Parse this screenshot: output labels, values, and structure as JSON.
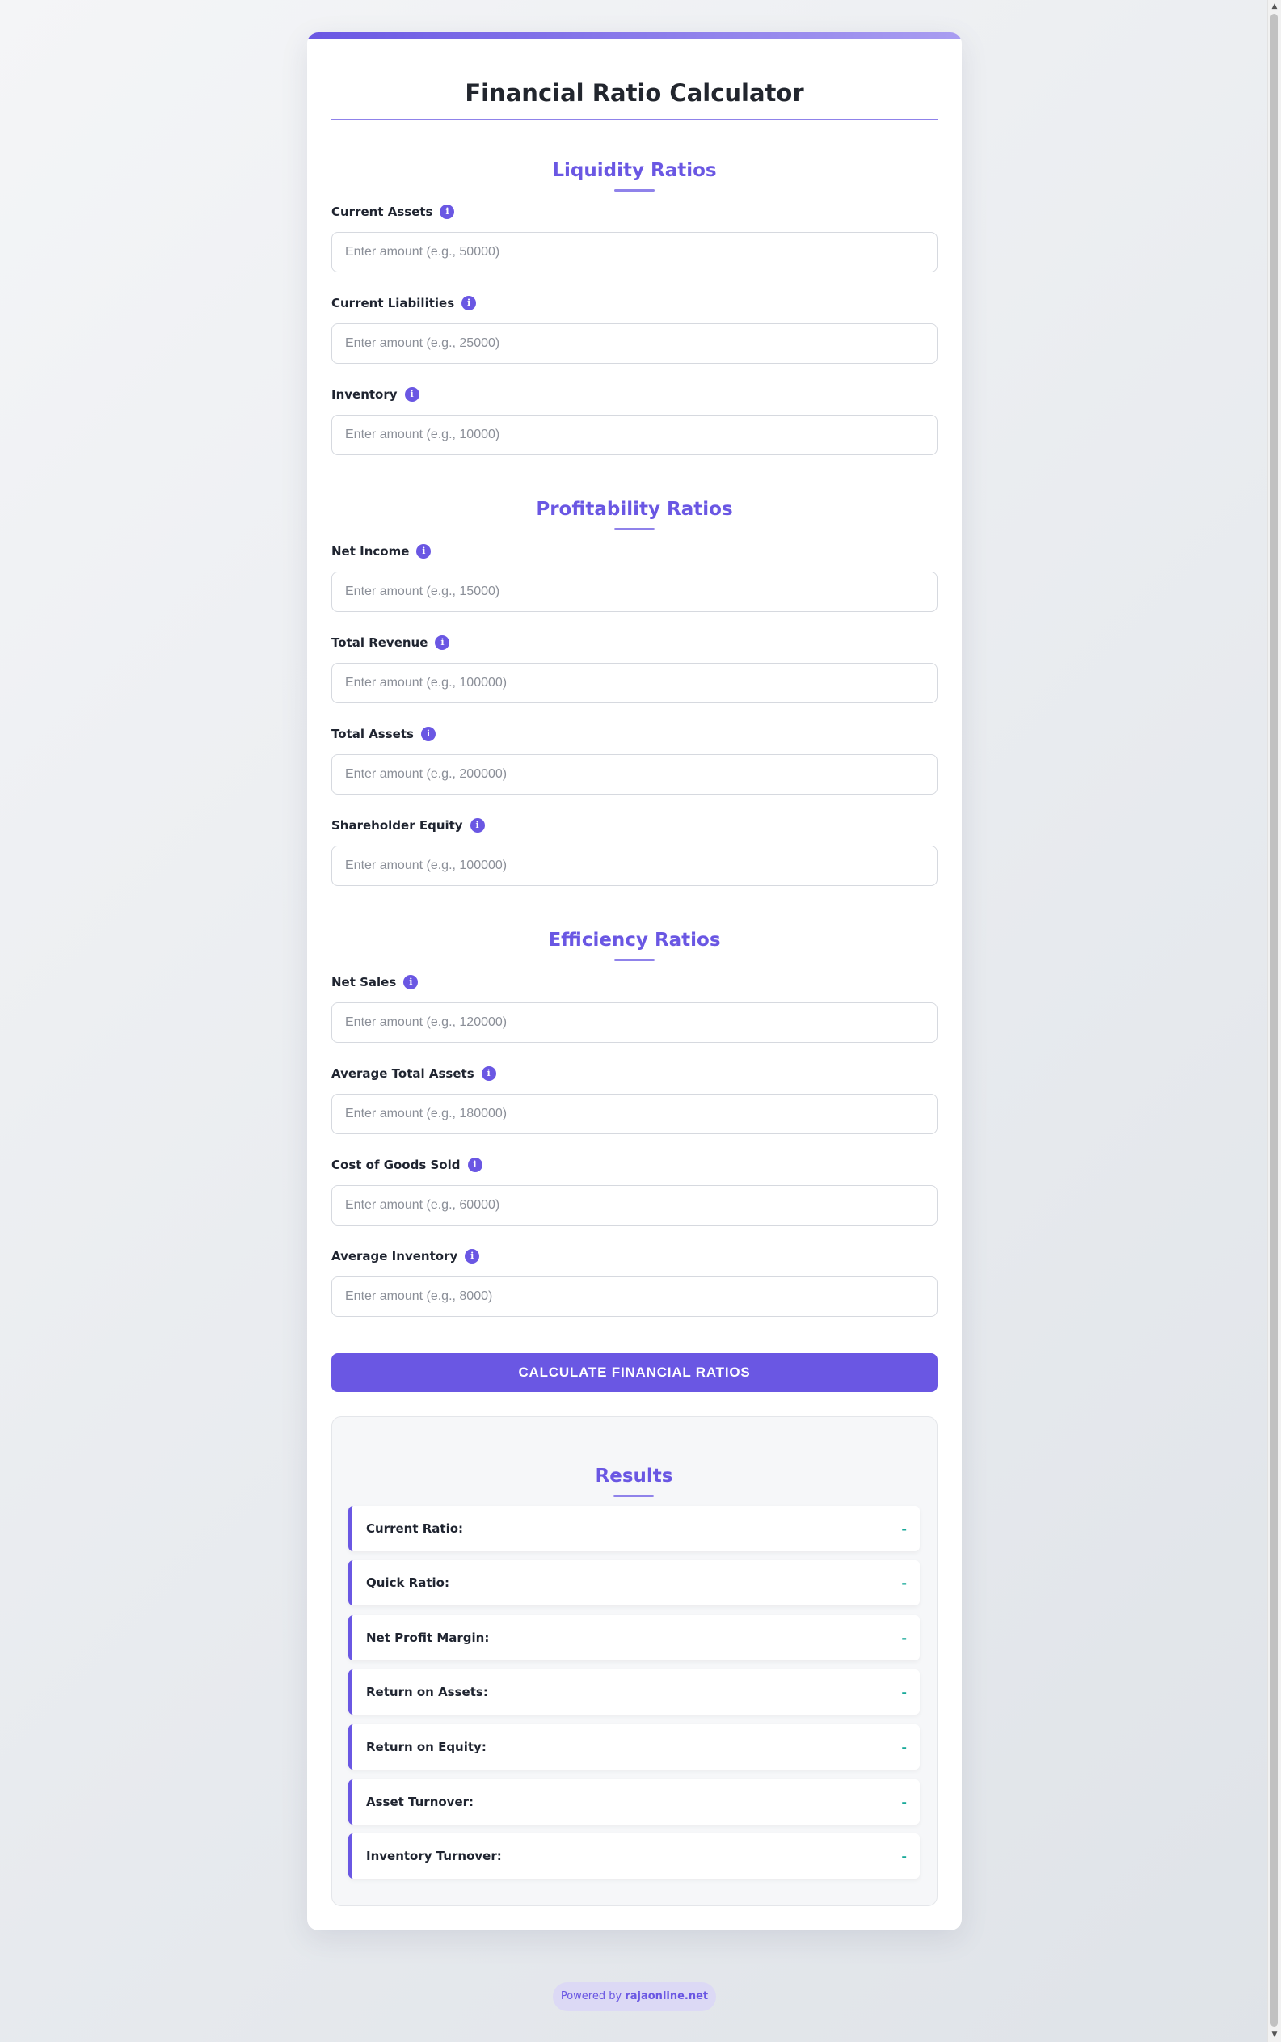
{
  "title": "Financial Ratio Calculator",
  "sections": [
    {
      "title": "Liquidity Ratios",
      "fields": [
        {
          "label": "Current Assets",
          "placeholder": "Enter amount (e.g., 50000)",
          "value": ""
        },
        {
          "label": "Current Liabilities",
          "placeholder": "Enter amount (e.g., 25000)",
          "value": ""
        },
        {
          "label": "Inventory",
          "placeholder": "Enter amount (e.g., 10000)",
          "value": ""
        }
      ]
    },
    {
      "title": "Profitability Ratios",
      "fields": [
        {
          "label": "Net Income",
          "placeholder": "Enter amount (e.g., 15000)",
          "value": ""
        },
        {
          "label": "Total Revenue",
          "placeholder": "Enter amount (e.g., 100000)",
          "value": ""
        },
        {
          "label": "Total Assets",
          "placeholder": "Enter amount (e.g., 200000)",
          "value": ""
        },
        {
          "label": "Shareholder Equity",
          "placeholder": "Enter amount (e.g., 100000)",
          "value": ""
        }
      ]
    },
    {
      "title": "Efficiency Ratios",
      "fields": [
        {
          "label": "Net Sales",
          "placeholder": "Enter amount (e.g., 120000)",
          "value": ""
        },
        {
          "label": "Average Total Assets",
          "placeholder": "Enter amount (e.g., 180000)",
          "value": ""
        },
        {
          "label": "Cost of Goods Sold",
          "placeholder": "Enter amount (e.g., 60000)",
          "value": ""
        },
        {
          "label": "Average Inventory",
          "placeholder": "Enter amount (e.g., 8000)",
          "value": ""
        }
      ]
    }
  ],
  "info_icon": {
    "name": "info-icon",
    "glyph": "i"
  },
  "calculate_button": "CALCULATE FINANCIAL RATIOS",
  "results": {
    "title": "Results",
    "items": [
      {
        "label": "Current Ratio:",
        "value": "-"
      },
      {
        "label": "Quick Ratio:",
        "value": "-"
      },
      {
        "label": "Net Profit Margin:",
        "value": "-"
      },
      {
        "label": "Return on Assets:",
        "value": "-"
      },
      {
        "label": "Return on Equity:",
        "value": "-"
      },
      {
        "label": "Asset Turnover:",
        "value": "-"
      },
      {
        "label": "Inventory Turnover:",
        "value": "-"
      }
    ]
  },
  "footer": {
    "prefix": "Powered by",
    "link": "rajaonline.net"
  },
  "colors": {
    "accent": "#6a57e3",
    "value": "#18a999"
  }
}
